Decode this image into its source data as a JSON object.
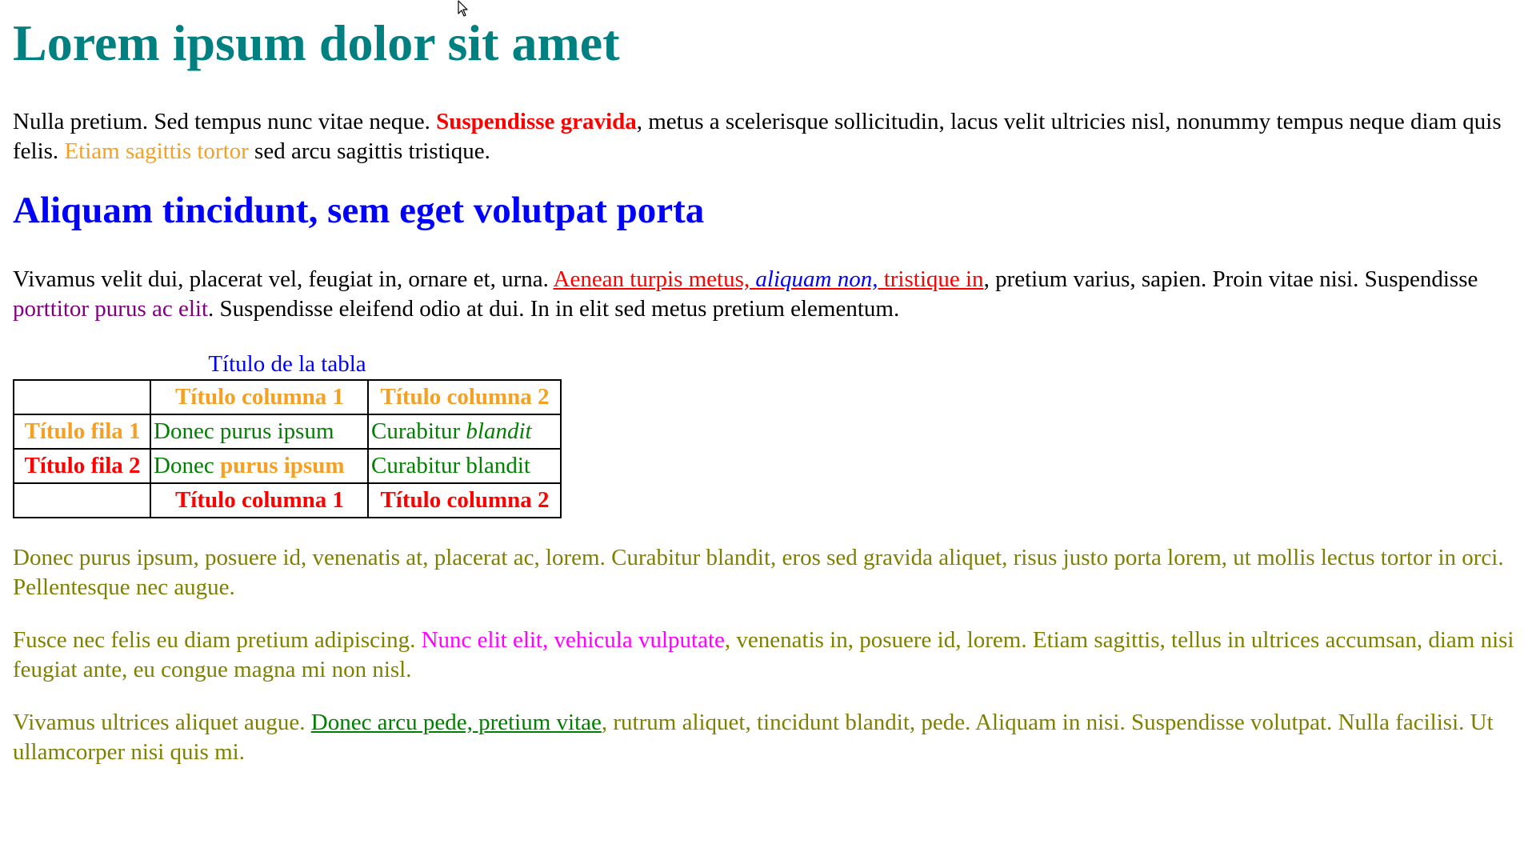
{
  "heading1": "Lorem ipsum dolor sit amet",
  "para1": {
    "t1": "Nulla pretium. Sed tempus nunc vitae neque. ",
    "bold_red": "Suspendisse gravida",
    "t2": ", metus a scelerisque sollicitudin, lacus velit ultricies nisl, nonummy tempus neque diam quis felis. ",
    "orange": "Etiam sagittis tortor",
    "t3": " sed arcu sagittis tristique."
  },
  "heading2": "Aliquam tincidunt, sem eget volutpat porta",
  "para2": {
    "t1": "Vivamus velit dui, placerat vel, feugiat in, ornare et, urna. ",
    "link_a": "Aenean turpis metus, ",
    "link_b": "aliquam non,",
    "link_c": " tristique in",
    "t2": ", pretium varius, sapien. Proin vitae nisi. Suspendisse ",
    "purple": "porttitor purus ac elit",
    "t3": ". Suspendisse eleifend odio at dui. In in elit sed metus pretium elementum."
  },
  "table": {
    "caption": "Título de la tabla",
    "header": [
      "",
      "Título columna 1",
      "Título columna 2"
    ],
    "row1": {
      "head": "Título fila 1",
      "c1": "Donec purus ipsum",
      "c2_plain": "Curabitur ",
      "c2_italic": "blandit"
    },
    "row2": {
      "head": "Título fila 2",
      "c1_plain": "Donec ",
      "c1_bold": "purus ipsum",
      "c2": "Curabitur blandit"
    },
    "footer": [
      "",
      "Título columna 1",
      "Título columna 2"
    ]
  },
  "para3": "Donec purus ipsum, posuere id, venenatis at, placerat ac, lorem. Curabitur blandit, eros sed gravida aliquet, risus justo porta lorem, ut mollis lectus tortor in orci. Pellentesque nec augue.",
  "para4": {
    "t1": "Fusce nec felis eu diam pretium adipiscing. ",
    "magenta": "Nunc elit elit, vehicula vulputate",
    "t2": ", venenatis in, posuere id, lorem. Etiam sagittis, tellus in ultrices accumsan, diam nisi feugiat ante, eu congue magna mi non nisl."
  },
  "para5": {
    "t1": "Vivamus ultrices aliquet augue. ",
    "link": "Donec arcu pede, pretium vitae",
    "t2": ", rutrum aliquet, tincidunt blandit, pede. Aliquam in nisi. Suspendisse volutpat. Nulla facilisi. Ut ullamcorper nisi quis mi."
  },
  "colors": {
    "teal": "#008080",
    "blue": "#0000ff",
    "red": "#ff0000",
    "orange": "#f5a022",
    "purple": "#800080",
    "olive": "#808000",
    "magenta": "#ff00ff",
    "green": "#008000"
  },
  "icons": {
    "cursor": "mouse-pointer-icon"
  }
}
